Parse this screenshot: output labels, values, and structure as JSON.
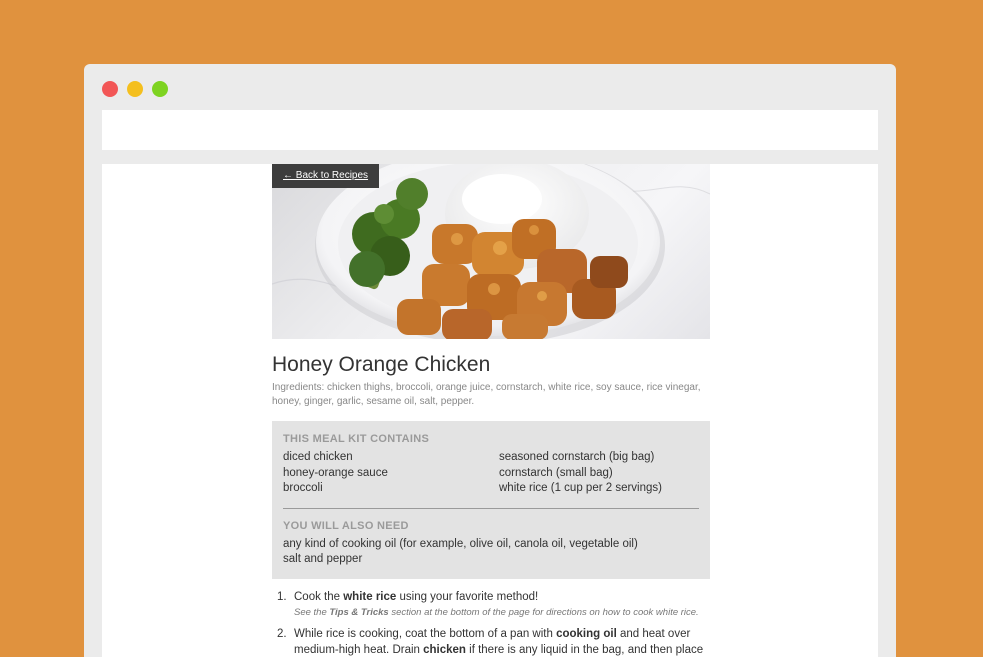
{
  "window": {
    "controls": {
      "close_color": "#f25656",
      "minimize_color": "#f4bf1e",
      "zoom_color": "#7ed321"
    }
  },
  "colors": {
    "background": "#e0923e",
    "kit_box": "#e3e3e3",
    "back_button": "#3d3d3d"
  },
  "recipe": {
    "back_label": "← Back to Recipes",
    "image_icon": "orange-chicken-rice-broccoli-bowl",
    "title": "Honey Orange Chicken",
    "ingredients": "Ingredients: chicken thighs, broccoli, orange juice, cornstarch, white rice, soy sauce, rice vinegar, honey, ginger, garlic, sesame oil, salt, pepper."
  },
  "kit": {
    "contains_heading": "THIS MEAL KIT CONTAINS",
    "contains_items": [
      "diced chicken",
      "seasoned cornstarch (big bag)",
      "honey-orange sauce",
      "cornstarch (small bag)",
      "broccoli",
      "white rice (1 cup per 2 servings)"
    ],
    "need_heading": "YOU WILL ALSO NEED",
    "need_items": [
      "any kind of cooking oil (for example, olive oil, canola oil, vegetable oil)",
      "salt and pepper"
    ]
  },
  "steps": [
    {
      "number": "1.",
      "parts": [
        "Cook the ",
        "white rice",
        " using your favorite method!"
      ],
      "note_parts": [
        "See the ",
        "Tips & Tricks",
        " section at the bottom of the page for directions on how to cook white rice."
      ]
    },
    {
      "number": "2.",
      "parts": [
        "While rice is cooking, coat the bottom of a pan with ",
        "cooking oil",
        " and heat over medium-high heat. Drain ",
        "chicken",
        " if there is any liquid in the bag, and then place the chicken"
      ]
    }
  ]
}
